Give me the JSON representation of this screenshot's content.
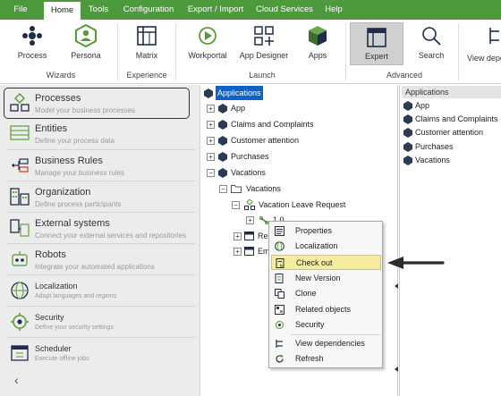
{
  "menubar": {
    "tabs": [
      "File",
      "Home",
      "Tools",
      "Configuration",
      "Export / Import",
      "Cloud Services",
      "Help"
    ],
    "active": "Home"
  },
  "ribbon": {
    "buttons": {
      "process": "Process",
      "persona": "Persona",
      "matrix": "Matrix",
      "workportal": "Workportal",
      "app_designer": "App Designer",
      "apps": "Apps",
      "expert": "Expert",
      "search": "Search",
      "view_dependencies": "View depe"
    },
    "groups": {
      "wizards": "Wizards",
      "experience": "Experience",
      "launch": "Launch",
      "advanced": "Advanced"
    },
    "selected": "expert"
  },
  "leftnav": {
    "items": [
      {
        "title": "Processes",
        "subtitle": "Model your business processes",
        "icon": "processes-icon"
      },
      {
        "title": "Entities",
        "subtitle": "Define your process data",
        "icon": "entities-icon"
      },
      {
        "title": "Business Rules",
        "subtitle": "Manage your business rules",
        "icon": "business-rules-icon"
      },
      {
        "title": "Organization",
        "subtitle": "Define process participants",
        "icon": "organization-icon"
      },
      {
        "title": "External systems",
        "subtitle": "Connect your external services and repositories",
        "icon": "external-systems-icon"
      },
      {
        "title": "Robots",
        "subtitle": "Integrate your automated applications",
        "icon": "robots-icon"
      },
      {
        "title": "Localization",
        "subtitle": "Adapt languages and regions",
        "icon": "localization-icon"
      },
      {
        "title": "Security",
        "subtitle": "Define your security settings",
        "icon": "security-icon"
      },
      {
        "title": "Scheduler",
        "subtitle": "Execute offline jobs",
        "icon": "scheduler-icon"
      }
    ],
    "selected": "Processes",
    "collapse_glyph": "‹"
  },
  "tree": {
    "root": "Applications",
    "apps": [
      "App",
      "Claims and Complaints",
      "Customer attention",
      "Purchases",
      "Vacations"
    ],
    "vacations_folder": "Vacations",
    "process": "Vacation Leave Request",
    "version": "1.0",
    "truncated_children": [
      "Re",
      "Em"
    ]
  },
  "context_menu": {
    "items": [
      {
        "label": "Properties",
        "icon": "properties-icon"
      },
      {
        "label": "Localization",
        "icon": "localization-icon"
      },
      {
        "label": "Check out",
        "icon": "check-out-icon"
      },
      {
        "label": "New Version",
        "icon": "new-version-icon"
      },
      {
        "label": "Clone",
        "icon": "clone-icon"
      },
      {
        "label": "Related objects",
        "icon": "related-objects-icon"
      },
      {
        "label": "Security",
        "icon": "security-icon"
      },
      {
        "label": "View dependencies",
        "icon": "view-dependencies-icon"
      },
      {
        "label": "Refresh",
        "icon": "refresh-icon"
      }
    ],
    "highlighted": "Check out"
  },
  "rightpane": {
    "header": "Applications",
    "items": [
      "App",
      "Claims and Complaints",
      "Customer attention",
      "Purchases",
      "Vacations"
    ]
  },
  "colors": {
    "menubar": "#4c9a3c",
    "brand_green": "#5a9a32",
    "selection_blue": "#0a64c8",
    "highlight_yellow": "#f6ec9e",
    "cube_dark": "#2b3a55"
  }
}
